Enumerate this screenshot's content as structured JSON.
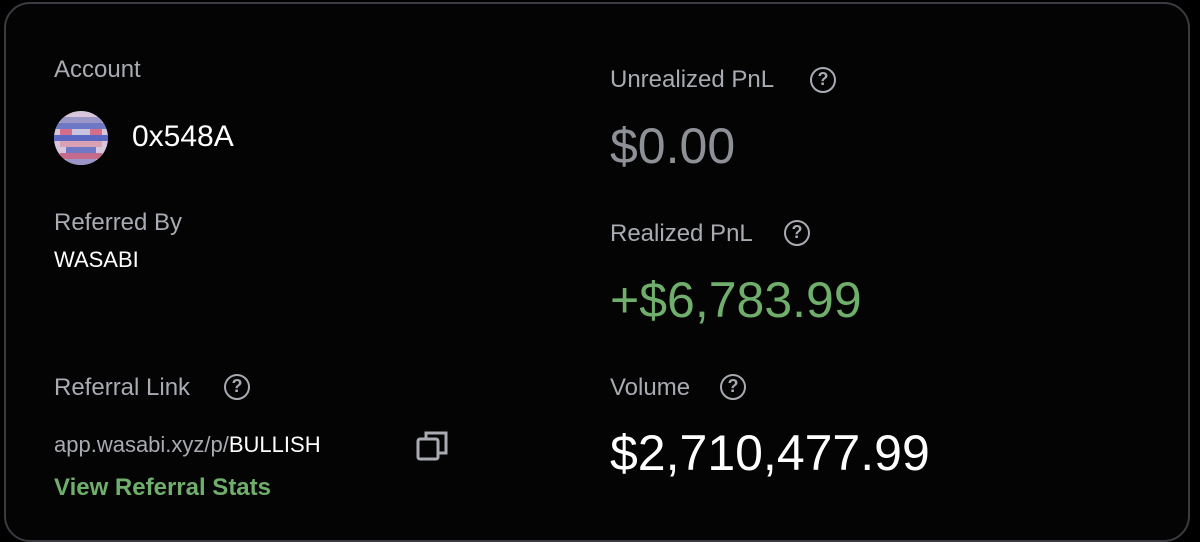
{
  "account": {
    "label": "Account",
    "address": "0x548A",
    "avatar_icon": "pixel-avatar"
  },
  "referred_by": {
    "label": "Referred By",
    "value": "WASABI"
  },
  "referral_link": {
    "label": "Referral Link",
    "url_prefix": "app.wasabi.xyz/p/",
    "code": "BULLISH",
    "copy_icon": "copy-icon",
    "stats_link": "View Referral Stats"
  },
  "unrealized_pnl": {
    "label": "Unrealized PnL",
    "value": "$0.00"
  },
  "realized_pnl": {
    "label": "Realized PnL",
    "value": "+$6,783.99"
  },
  "volume": {
    "label": "Volume",
    "value": "$2,710,477.99"
  },
  "help_glyph": "?",
  "colors": {
    "background": "#000000",
    "border": "#3a3a40",
    "label": "#a9abb2",
    "positive": "#6fae6b",
    "muted_value": "#8e9097",
    "link": "#6fae6b"
  }
}
